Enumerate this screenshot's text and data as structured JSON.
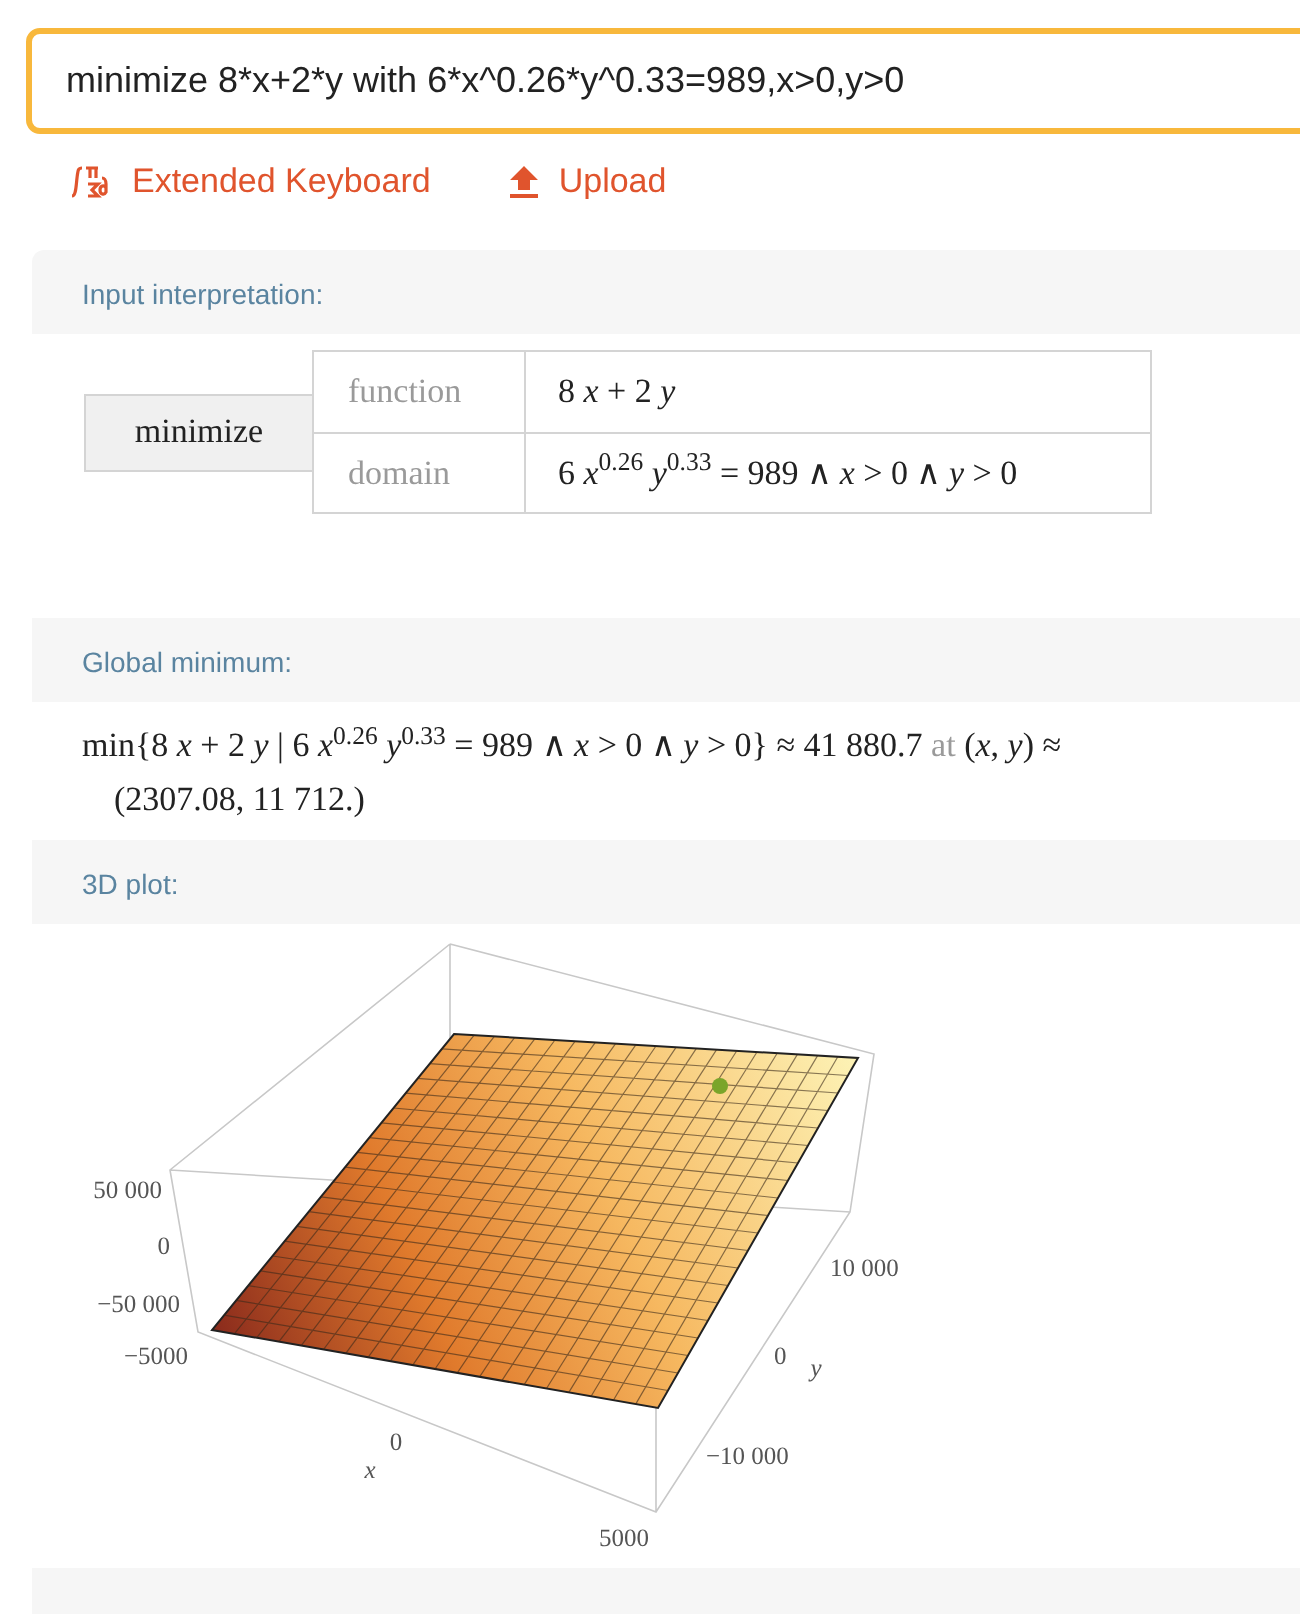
{
  "search": {
    "value": "minimize 8*x+2*y with 6*x^0.26*y^0.33=989,x>0,y>0"
  },
  "links": [
    {
      "label": "Extended Keyboard",
      "kind": "keyboard"
    },
    {
      "label": "Upload",
      "kind": "upload"
    }
  ],
  "pods": [
    {
      "kind": "interpretation",
      "title": "Input interpretation:",
      "action": "minimize",
      "rows": [
        {
          "label": "function",
          "value": "8 *x* + 2 *y*"
        },
        {
          "label": "domain",
          "value": "6 *x*$^{0.26}$ *y*$^{0.33}$ = 989 ∧ *x* > 0 ∧ *y* > 0"
        }
      ]
    },
    {
      "kind": "result",
      "title": "Global minimum:",
      "expression": "min{8 *x* + 2 *y* | 6 *x*$^{0.26}$ *y*$^{0.33}$ = 989 ∧ *x* > 0 ∧ *y* > 0} ≈ 41 880.7",
      "connector": "at",
      "point_label": "(*x*, *y*) ≈",
      "point_value": "(2307.08, 11 712.)"
    },
    {
      "kind": "plot3d",
      "title": "3D plot:",
      "z_ticks": [
        "50 000",
        "0",
        "−50 000"
      ],
      "x_ticks": [
        "−5000",
        "0",
        "5000"
      ],
      "x_label": "x",
      "y_ticks": [
        "10 000",
        "0",
        "−10 000"
      ],
      "y_label": "y"
    }
  ]
}
